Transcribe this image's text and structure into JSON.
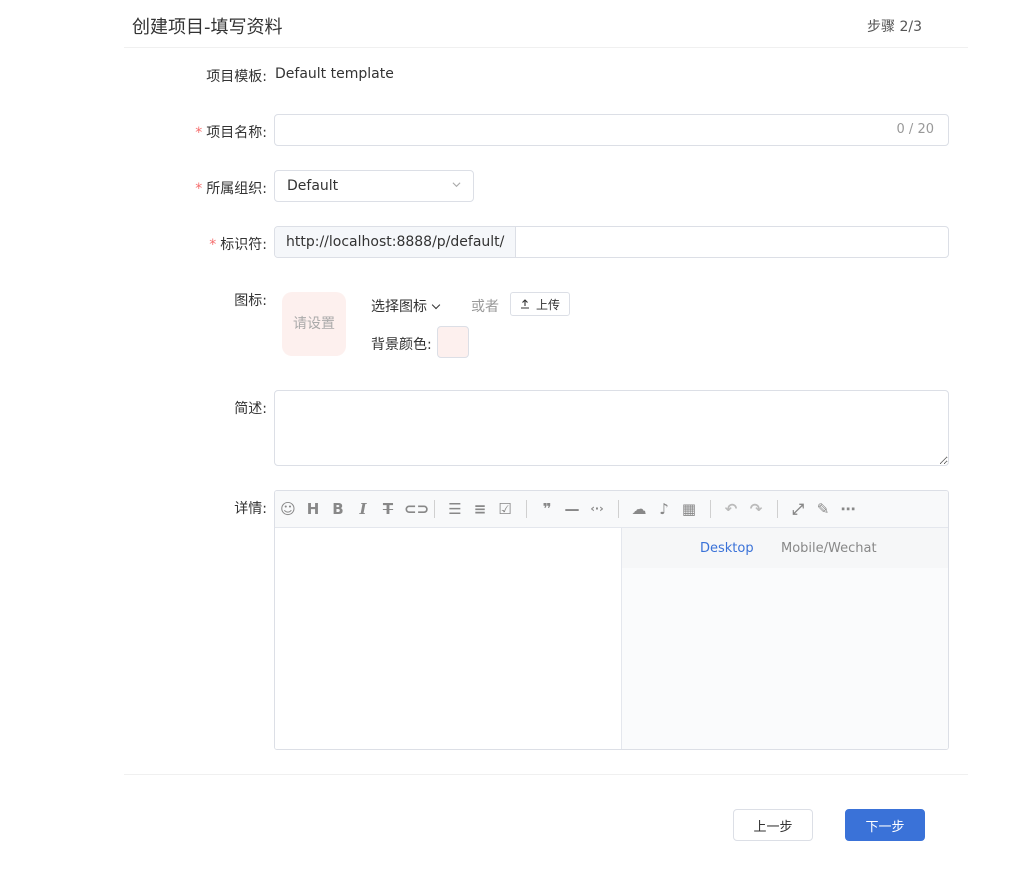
{
  "header": {
    "title": "创建项目-填写资料",
    "step": "步骤 2/3"
  },
  "form": {
    "template": {
      "label": "项目模板:",
      "value": "Default template"
    },
    "name": {
      "label": "项目名称:",
      "value": "",
      "counter": "0 / 20"
    },
    "organization": {
      "label": "所属组织:",
      "value": "Default"
    },
    "identifier": {
      "label": "标识符:",
      "prefix": "http://localhost:8888/p/default/",
      "value": ""
    },
    "icon": {
      "label": "图标:",
      "placeholder": "请设置",
      "choose_label": "选择图标",
      "or_label": "或者",
      "upload_label": "上传",
      "bg_color_label": "背景颜色:",
      "bg_color": "#fdf0ee"
    },
    "description": {
      "label": "简述:",
      "value": ""
    },
    "details": {
      "label": "详情:",
      "preview_tabs": [
        "Desktop",
        "Mobile/Wechat"
      ],
      "active_tab": "Desktop"
    }
  },
  "toolbar_icons": [
    "emoji-icon",
    "heading-icon",
    "bold-icon",
    "italic-icon",
    "strikethrough-icon",
    "link-icon",
    "unordered-list-icon",
    "ordered-list-icon",
    "checklist-icon",
    "quote-icon",
    "horizontal-rule-icon",
    "code-icon",
    "upload-cloud-icon",
    "microphone-icon",
    "table-icon",
    "undo-icon",
    "redo-icon",
    "fullscreen-icon",
    "edit-icon",
    "more-icon"
  ],
  "footer": {
    "prev_label": "上一步",
    "next_label": "下一步"
  },
  "colors": {
    "primary": "#3a72d8",
    "required": "#f56c6c"
  }
}
